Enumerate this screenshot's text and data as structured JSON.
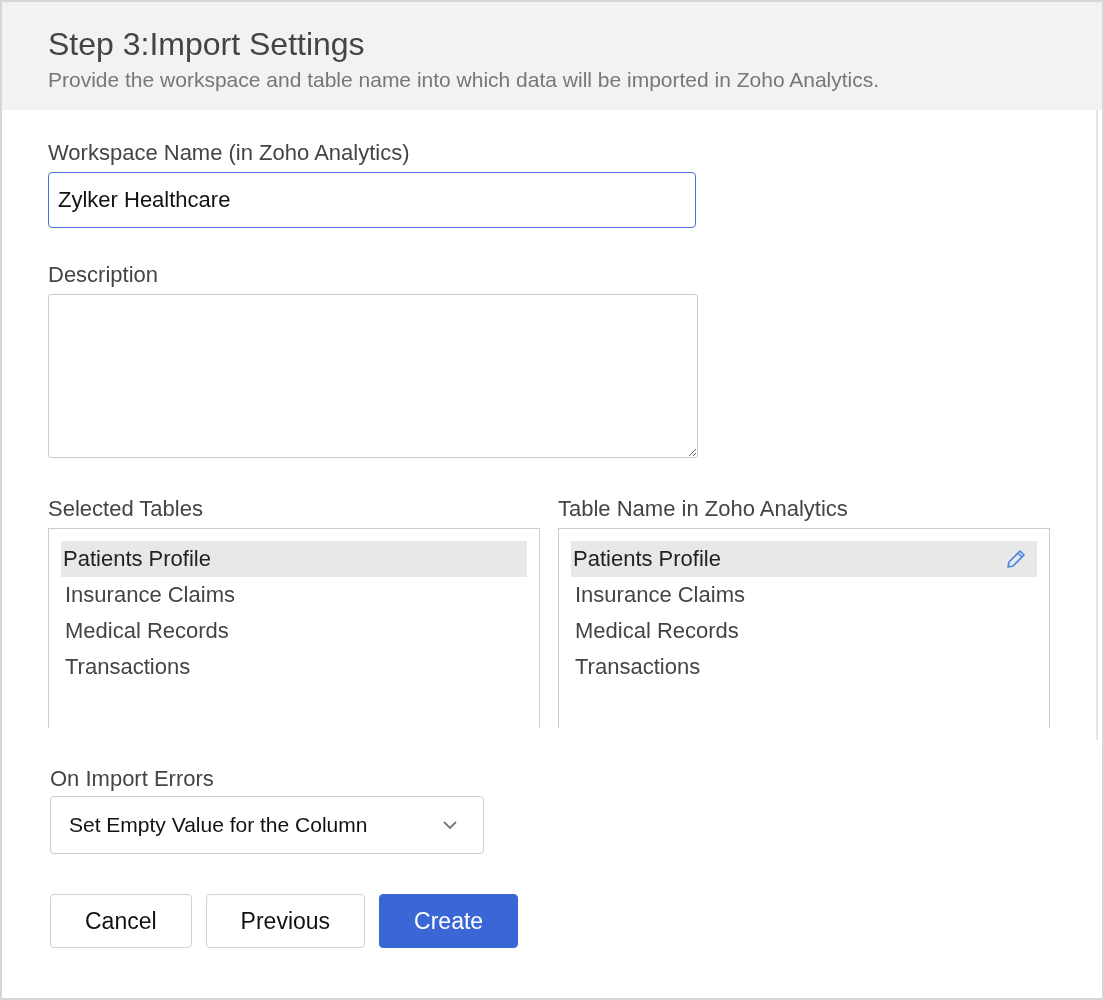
{
  "header": {
    "title": "Step 3:Import Settings",
    "subtitle": "Provide the workspace and table name into which data will be imported in Zoho Analytics."
  },
  "workspace": {
    "label": "Workspace Name (in Zoho Analytics)",
    "value": "Zylker Healthcare"
  },
  "description": {
    "label": "Description"
  },
  "selected_tables": {
    "label": "Selected Tables",
    "items": [
      {
        "name": "Patients Profile",
        "selected": true
      },
      {
        "name": "Insurance Claims",
        "selected": false
      },
      {
        "name": "Medical Records",
        "selected": false
      },
      {
        "name": "Transactions",
        "selected": false
      }
    ]
  },
  "table_names": {
    "label": "Table Name in Zoho Analytics",
    "items": [
      {
        "name": "Patients Profile",
        "selected": true
      },
      {
        "name": "Insurance Claims",
        "selected": false
      },
      {
        "name": "Medical Records",
        "selected": false
      },
      {
        "name": "Transactions",
        "selected": false
      }
    ]
  },
  "import_errors": {
    "label": "On Import Errors",
    "value": "Set Empty Value for the Column"
  },
  "buttons": [
    {
      "label": "Cancel",
      "kind": "default"
    },
    {
      "label": "Previous",
      "kind": "default"
    },
    {
      "label": "Create",
      "kind": "primary"
    }
  ]
}
